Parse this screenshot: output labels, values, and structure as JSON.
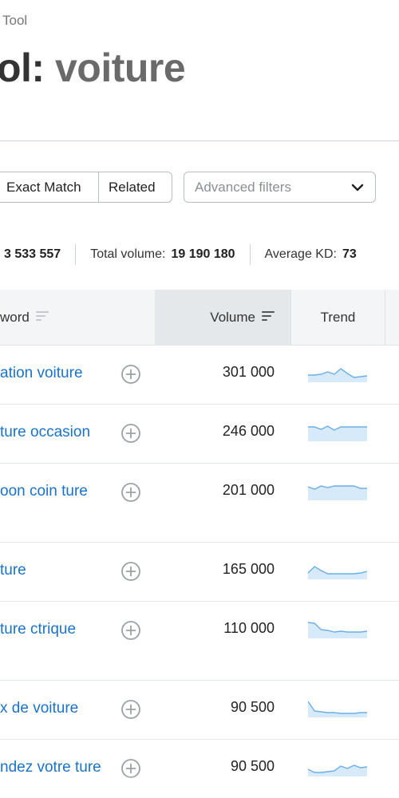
{
  "header": {
    "breadcrumb": "Tool",
    "title_prefix": "ol:",
    "title_keyword": "voiture"
  },
  "filters": {
    "exact_match": "Exact Match",
    "related": "Related",
    "advanced_placeholder": "Advanced filters"
  },
  "stats": {
    "keywords_value": "3 533 557",
    "total_volume_label": "Total volume:",
    "total_volume_value": "19 190 180",
    "average_kd_label": "Average KD:",
    "average_kd_value": "73"
  },
  "table": {
    "columns": {
      "keyword": "word",
      "volume": "Volume",
      "trend": "Trend"
    },
    "rows": [
      {
        "keyword": "ation voiture",
        "volume": "301 000",
        "trend": [
          0.35,
          0.35,
          0.4,
          0.55,
          0.4,
          0.75,
          0.45,
          0.2,
          0.25,
          0.3
        ]
      },
      {
        "keyword": "ture occasion",
        "volume": "246 000",
        "trend": [
          0.8,
          0.8,
          0.65,
          0.85,
          0.6,
          0.8,
          0.8,
          0.8,
          0.8,
          0.8
        ]
      },
      {
        "keyword": "oon coin ture",
        "volume": "201 000",
        "trend": [
          0.75,
          0.6,
          0.8,
          0.7,
          0.8,
          0.8,
          0.8,
          0.8,
          0.65,
          0.65
        ]
      },
      {
        "keyword": "ture",
        "volume": "165 000",
        "trend": [
          0.3,
          0.7,
          0.45,
          0.25,
          0.25,
          0.25,
          0.25,
          0.25,
          0.3,
          0.4
        ]
      },
      {
        "keyword": "ture ctrique",
        "volume": "110 000",
        "trend": [
          0.9,
          0.85,
          0.45,
          0.4,
          0.3,
          0.35,
          0.3,
          0.3,
          0.3,
          0.35
        ]
      },
      {
        "keyword": "x de voiture",
        "volume": "90 500",
        "trend": [
          0.9,
          0.3,
          0.25,
          0.2,
          0.2,
          0.15,
          0.15,
          0.15,
          0.2,
          0.2
        ]
      },
      {
        "keyword": "ndez votre ture",
        "volume": "90 500",
        "trend": [
          0.35,
          0.15,
          0.15,
          0.2,
          0.25,
          0.55,
          0.4,
          0.6,
          0.45,
          0.5
        ]
      }
    ]
  },
  "colors": {
    "link": "#1a73c7",
    "trend_line": "#6aaee6",
    "trend_fill": "#d7eafa",
    "header_bg": "#f4f5f6"
  },
  "icons": {
    "add": "plus-circle-icon",
    "sort": "sort-icon",
    "dropdown": "chevron-down-icon"
  }
}
